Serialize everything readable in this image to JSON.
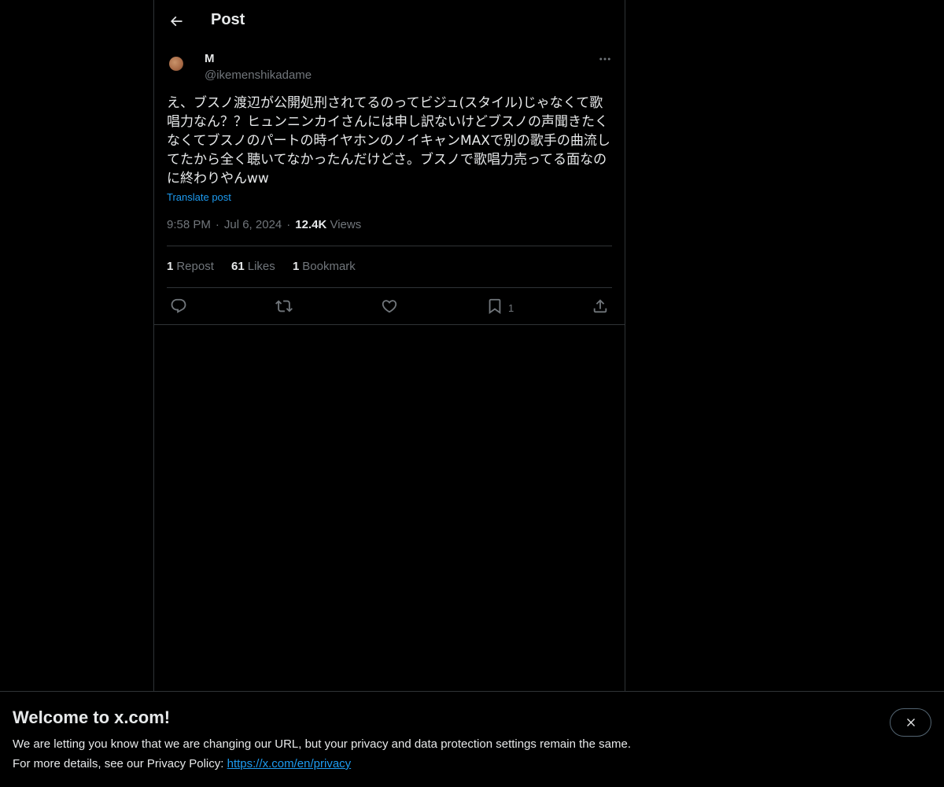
{
  "header": {
    "title": "Post"
  },
  "post": {
    "display_name": "M",
    "handle": "@ikemenshikadame",
    "text": "え、ブスノ渡辺が公開処刑されてるのってビジュ(スタイル)じゃなくて歌唱力なん？？ヒュンニンカイさんには申し訳ないけどブスノの声聞きたくなくてブスノのパートの時イヤホンのノイキャンMAXで別の歌手の曲流してたから全く聴いてなかったんだけどさ。ブスノで歌唱力売ってる面なのに終わりやんww",
    "translate_label": "Translate post",
    "time": "9:58 PM",
    "date": "Jul 6, 2024",
    "meta_sep": "·",
    "views_count": "12.4K",
    "views_label": "Views"
  },
  "stats": {
    "reposts_count": "1",
    "reposts_label": "Repost",
    "likes_count": "61",
    "likes_label": "Likes",
    "bookmarks_count": "1",
    "bookmarks_label": "Bookmark"
  },
  "actions": {
    "bookmark_count": "1"
  },
  "banner": {
    "title": "Welcome to x.com!",
    "line1": "We are letting you know that we are changing our URL, but your privacy and data protection settings remain the same.",
    "line2_prefix": "For more details, see our Privacy Policy:",
    "link_text": "https://x.com/en/privacy"
  },
  "colors": {
    "background": "#000000",
    "text_primary": "#e7e9ea",
    "text_secondary": "#71767b",
    "accent": "#1d9bf0",
    "border": "#2f3336"
  }
}
